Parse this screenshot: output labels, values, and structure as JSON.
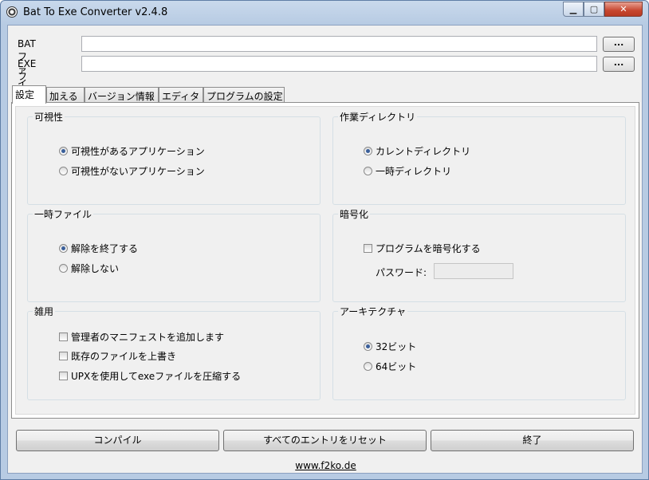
{
  "window": {
    "title": "Bat To Exe Converter v2.4.8",
    "min_glyph": "▁",
    "max_glyph": "▢",
    "close_glyph": "✕"
  },
  "files": {
    "bat_label": "BATファイル",
    "bat_value": "",
    "bat_browse": "...",
    "exe_label": "EXEファイル",
    "exe_value": "",
    "exe_browse": "..."
  },
  "tabs": [
    {
      "label": "設定",
      "active": true
    },
    {
      "label": "加える",
      "active": false
    },
    {
      "label": "バージョン情報",
      "active": false
    },
    {
      "label": "エディタ",
      "active": false
    },
    {
      "label": "プログラムの設定",
      "active": false
    }
  ],
  "groups": {
    "visibility": {
      "title": "可視性",
      "options": [
        {
          "label": "可視性があるアプリケーション",
          "selected": true
        },
        {
          "label": "可視性がないアプリケーション",
          "selected": false
        }
      ]
    },
    "workdir": {
      "title": "作業ディレクトリ",
      "options": [
        {
          "label": "カレントディレクトリ",
          "selected": true
        },
        {
          "label": "一時ディレクトリ",
          "selected": false
        }
      ]
    },
    "tempfile": {
      "title": "一時ファイル",
      "options": [
        {
          "label": "解除を終了する",
          "selected": true
        },
        {
          "label": "解除しない",
          "selected": false
        }
      ]
    },
    "encryption": {
      "title": "暗号化",
      "encrypt_label": "プログラムを暗号化する",
      "encrypt_checked": false,
      "password_label": "パスワード:",
      "password_value": ""
    },
    "misc": {
      "title": "雑用",
      "options": [
        {
          "label": "管理者のマニフェストを追加します",
          "checked": false
        },
        {
          "label": "既存のファイルを上書き",
          "checked": false
        },
        {
          "label": "UPXを使用してexeファイルを圧縮する",
          "checked": false
        }
      ]
    },
    "arch": {
      "title": "アーキテクチャ",
      "options": [
        {
          "label": "32ビット",
          "selected": true
        },
        {
          "label": "64ビット",
          "selected": false
        }
      ]
    }
  },
  "buttons": {
    "compile": "コンパイル",
    "reset": "すべてのエントリをリセット",
    "exit": "終了"
  },
  "footer": {
    "link": "www.f2ko.de"
  }
}
